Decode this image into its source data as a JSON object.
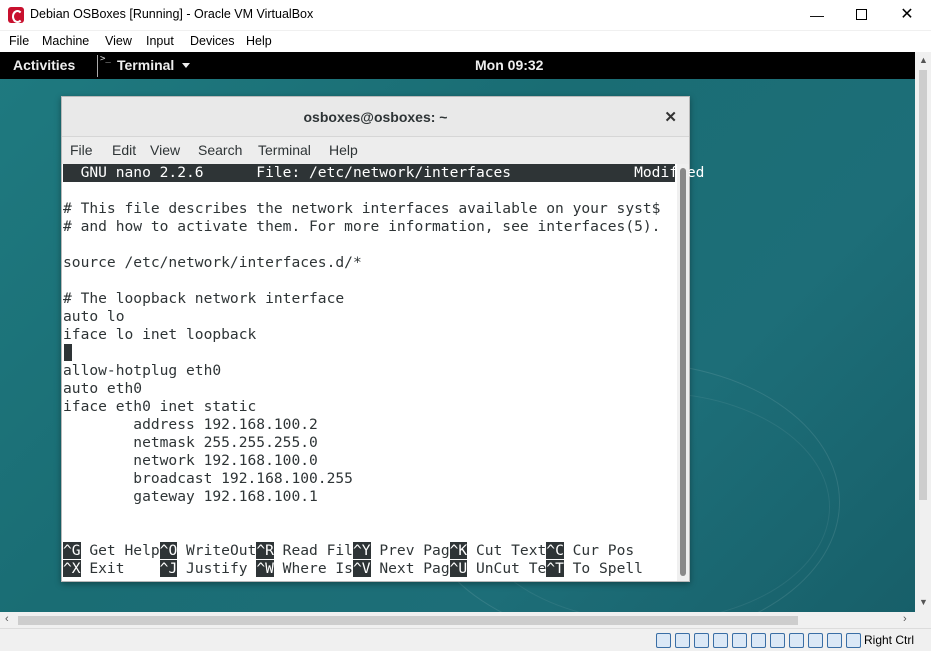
{
  "host_window": {
    "title": "Debian OSBoxes [Running] - Oracle VM VirtualBox",
    "minimize_glyph": "—",
    "close_glyph": "✕",
    "menu": [
      "File",
      "Machine",
      "View",
      "Input",
      "Devices",
      "Help"
    ]
  },
  "gnome_topbar": {
    "activities": "Activities",
    "app_name": "Terminal",
    "clock": "Mon 09:32",
    "terminal_icon_glyph": ">_"
  },
  "terminal": {
    "title": "osboxes@osboxes: ~",
    "close_glyph": "✕",
    "menu": [
      "File",
      "Edit",
      "View",
      "Search",
      "Terminal",
      "Help"
    ]
  },
  "nano": {
    "header": "  GNU nano 2.2.6      File: /etc/network/interfaces              Modified  ",
    "lines": [
      "",
      "# This file describes the network interfaces available on your syst$",
      "# and how to activate them. For more information, see interfaces(5).",
      "",
      "source /etc/network/interfaces.d/*",
      "",
      "# The loopback network interface",
      "auto lo",
      "iface lo inet loopback",
      "",
      "allow-hotplug eth0",
      "auto eth0",
      "iface eth0 inet static",
      "        address 192.168.100.2",
      "        netmask 255.255.255.0",
      "        network 192.168.100.0",
      "        broadcast 192.168.100.255",
      "        gateway 192.168.100.1"
    ],
    "shortcuts_row1": [
      {
        "key": "^G",
        "label": " Get Help"
      },
      {
        "key": "^O",
        "label": " WriteOut"
      },
      {
        "key": "^R",
        "label": " Read Fil"
      },
      {
        "key": "^Y",
        "label": " Prev Pag"
      },
      {
        "key": "^K",
        "label": " Cut Text"
      },
      {
        "key": "^C",
        "label": " Cur Pos"
      }
    ],
    "shortcuts_row2": [
      {
        "key": "^X",
        "label": " Exit    "
      },
      {
        "key": "^J",
        "label": " Justify "
      },
      {
        "key": "^W",
        "label": " Where Is"
      },
      {
        "key": "^V",
        "label": " Next Pag"
      },
      {
        "key": "^U",
        "label": " UnCut Te"
      },
      {
        "key": "^T",
        "label": " To Spell"
      }
    ]
  },
  "statusbar": {
    "host_key": "Right Ctrl",
    "icons": [
      "hard-disk-icon",
      "optical-drive-icon",
      "audio-icon",
      "network-icon",
      "usb-icon",
      "shared-folders-icon",
      "display-icon",
      "video-capture-icon",
      "cpu-icon",
      "mouse-integration-icon",
      "keyboard-capture-icon"
    ]
  },
  "colors": {
    "vm_desktop": "#1f7a80",
    "terminal_fg": "#2e3436",
    "gnome_bar": "#000000"
  }
}
